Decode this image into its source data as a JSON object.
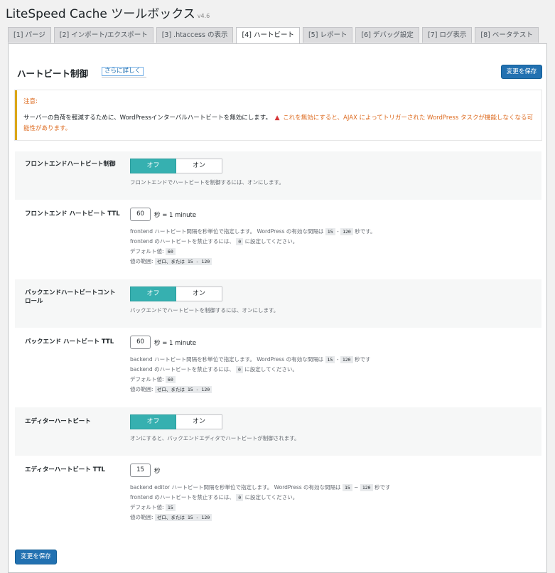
{
  "app": {
    "title": "LiteSpeed Cache ツールボックス",
    "version": "v4.6"
  },
  "tabs": [
    {
      "label": "[1] パージ"
    },
    {
      "label": "[2] インポート/エクスポート"
    },
    {
      "label": "[3] .htaccess の表示"
    },
    {
      "label": "[4] ハートビート",
      "active": true
    },
    {
      "label": "[5] レポート"
    },
    {
      "label": "[6] デバッグ設定"
    },
    {
      "label": "[7] ログ表示"
    },
    {
      "label": "[8] ベータテスト"
    }
  ],
  "section": {
    "title": "ハートビート制御",
    "learn_more": "さらに詳しく",
    "save_label": "変更を保存"
  },
  "notice": {
    "title": "注意:",
    "text": "サーバーの負荷を軽減するために、WordPressインターバルハートビートを無効にします。",
    "warning": "これを無効にすると、AJAX によってトリガーされた WordPress タスクが機能しなくなる可能性があります。"
  },
  "toggle": {
    "off": "オフ",
    "on": "オン"
  },
  "settings": {
    "front_control": {
      "label": "フロントエンドハートビート制御",
      "value": "オフ",
      "desc": "フロントエンドでハートビートを制御するには、オンにします。"
    },
    "front_ttl": {
      "label": "フロントエンド ハートビート TTL",
      "value": "60",
      "unit": "秒 = 1 minute",
      "help1_a": "frontend ハートビート間隔を秒単位で指定します。 WordPress の有効な間隔は",
      "help1_code1": "15",
      "help1_sep": " - ",
      "help1_code2": "120",
      "help1_b": "秒です。",
      "help2_a": "frontend のハートビートを禁止するには、",
      "help2_code": "0",
      "help2_b": "に設定してください。",
      "default_label": "デフォルト値:",
      "default_value": "60",
      "range_label": "値の範囲:",
      "range_value": "ゼロ、または 15 - 120"
    },
    "back_control": {
      "label": "バックエンドハートビートコントロール",
      "value": "オフ",
      "desc": "バックエンドでハートビートを制御するには、オンにします。"
    },
    "back_ttl": {
      "label": "バックエンド ハートビート TTL",
      "value": "60",
      "unit": "秒 = 1 minute",
      "help1_a": "backend ハートビート間隔を秒単位で指定します。 WordPress の有効な間隔は",
      "help1_code1": "15",
      "help1_sep": " - ",
      "help1_code2": "120",
      "help1_b": "秒です",
      "help2_a": "backend のハートビートを禁止するには、",
      "help2_code": "0",
      "help2_b": "に設定してください。",
      "default_label": "デフォルト値:",
      "default_value": "60",
      "range_label": "値の範囲:",
      "range_value": "ゼロ、または 15 - 120"
    },
    "editor_control": {
      "label": "エディターハートビート",
      "value": "オフ",
      "desc": "オンにすると、バックエンドエディタでハートビートが制御されます。"
    },
    "editor_ttl": {
      "label": "エディターハートビート TTL",
      "value": "15",
      "unit": "秒",
      "help1_a": "backend editor ハートビート間隔を秒単位で指定します。 WordPress の有効な間隔は",
      "help1_code1": "15",
      "help1_sep": " ~ ",
      "help1_code2": "120",
      "help1_b": "秒です",
      "help2_a": "frontend のハートビートを禁止するには、",
      "help2_code": "0",
      "help2_b": "に設定してください。",
      "default_label": "デフォルト値:",
      "default_value": "15",
      "range_label": "値の範囲:",
      "range_value": "ゼロ、または 15 - 120"
    }
  },
  "colors": {
    "primary": "#2271b1",
    "toggle_active": "#36b0b0",
    "notice_border": "#dba617",
    "warning": "#dd6b20"
  }
}
